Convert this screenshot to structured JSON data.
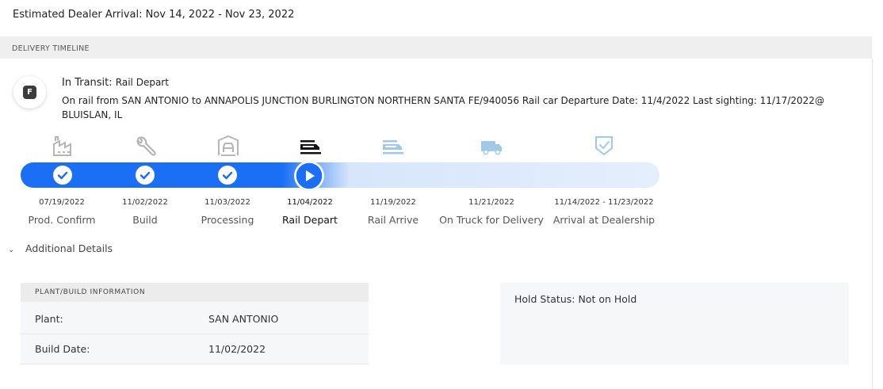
{
  "estimated_arrival": "Estimated Dealer Arrival: Nov 14, 2022 - Nov 23, 2022",
  "section_title": "DELIVERY TIMELINE",
  "status": {
    "badge_letter": "F",
    "title_prefix": "In Transit:",
    "title_value": "Rail Depart",
    "description": "On rail from SAN ANTONIO to ANNAPOLIS JUNCTION BURLINGTON NORTHERN SANTA FE/940056 Rail car Departure Date: 11/4/2022 Last sighting: 11/17/2022@ BLUISLAN, IL"
  },
  "stages": [
    {
      "date": "07/19/2022",
      "name": "Prod. Confirm",
      "icon": "factory-icon",
      "state": "complete"
    },
    {
      "date": "11/02/2022",
      "name": "Build",
      "icon": "wrench-icon",
      "state": "complete"
    },
    {
      "date": "11/03/2022",
      "name": "Processing",
      "icon": "garage-car-icon",
      "state": "complete"
    },
    {
      "date": "11/04/2022",
      "name": "Rail Depart",
      "icon": "rail-car-icon",
      "state": "current"
    },
    {
      "date": "11/19/2022",
      "name": "Rail Arrive",
      "icon": "rail-car-icon",
      "state": "upcoming"
    },
    {
      "date": "11/21/2022",
      "name": "On Truck for Delivery",
      "icon": "truck-icon",
      "state": "upcoming"
    },
    {
      "date": "11/14/2022 - 11/23/2022",
      "name": "Arrival at Dealership",
      "icon": "shield-check-icon",
      "state": "upcoming"
    }
  ],
  "additional_details_label": "Additional Details",
  "plant_info": {
    "header": "PLANT/BUILD INFORMATION",
    "plant_label": "Plant:",
    "plant_value": "SAN ANTONIO",
    "build_date_label": "Build Date:",
    "build_date_value": "11/02/2022"
  },
  "hold_status": "Hold Status: Not on Hold",
  "colors": {
    "progress_blue": "#1a6ff5",
    "track_light": "#e5eefc",
    "completed_icon": "#b5b5b5",
    "upcoming_icon": "#9fc9e6",
    "current_icon": "#111111"
  }
}
